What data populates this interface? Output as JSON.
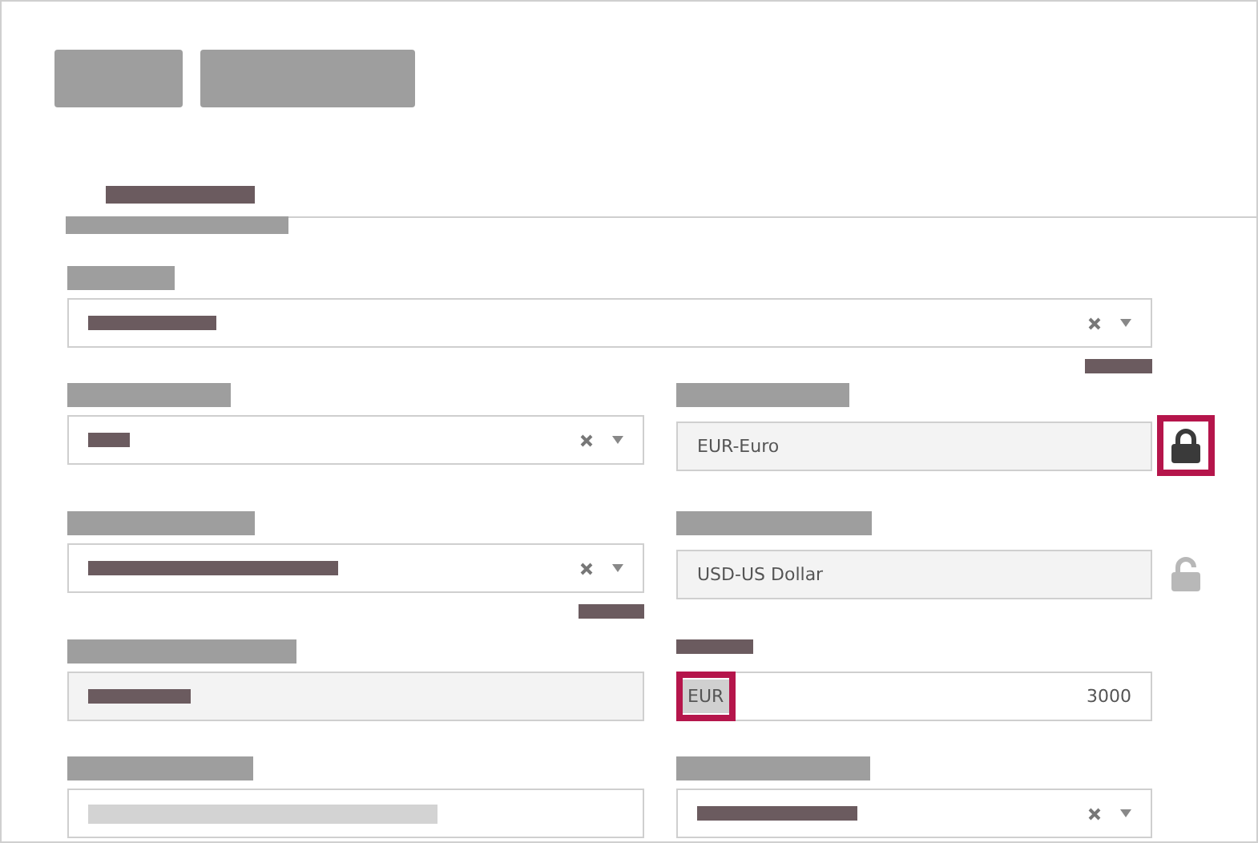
{
  "form": {
    "fields": [
      {
        "kind": "select"
      },
      {
        "kind": "select"
      },
      {
        "kind": "readonly",
        "value": "EUR-Euro",
        "lock": {
          "locked": true,
          "highlighted": true
        }
      },
      {
        "kind": "select"
      },
      {
        "kind": "readonly",
        "value": "USD-US Dollar",
        "lock": {
          "locked": false,
          "highlighted": false
        }
      },
      {
        "kind": "readonly"
      },
      {
        "kind": "amount",
        "currency": {
          "code": "EUR",
          "highlighted": true
        },
        "value": "3000"
      },
      {
        "kind": "text"
      },
      {
        "kind": "select"
      }
    ]
  }
}
